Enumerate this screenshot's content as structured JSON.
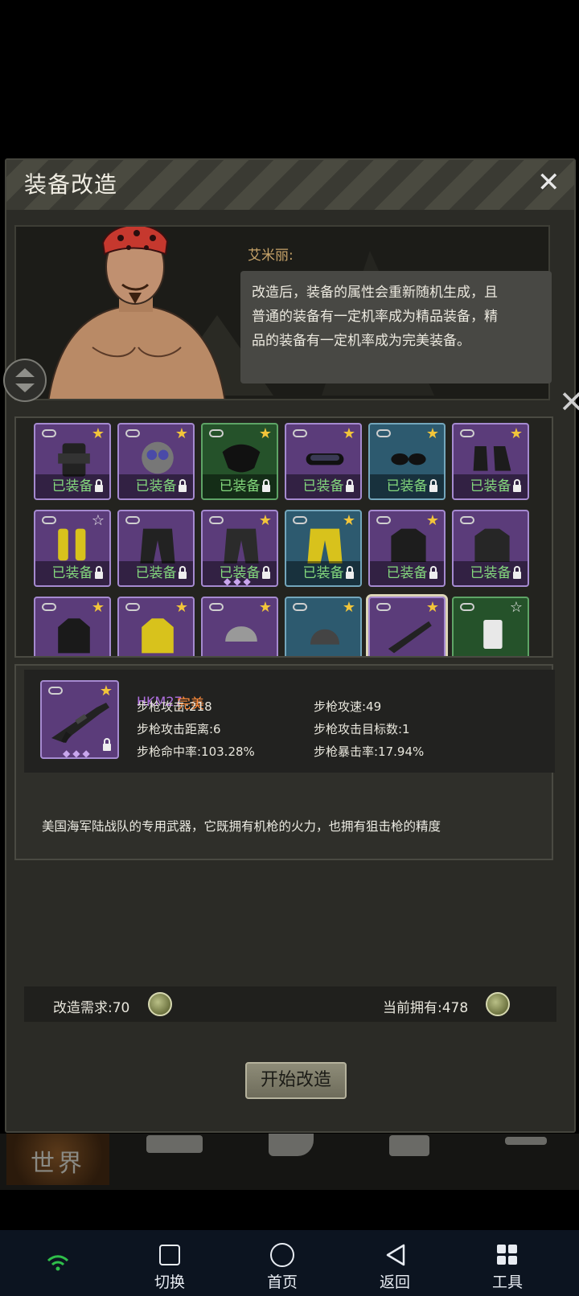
{
  "window": {
    "title": "装备改造"
  },
  "npc": {
    "speaker": "艾米丽:",
    "message_lines": [
      "改造后，装备的属性会重新随机生成，且",
      "普通的装备有一定机率成为精品装备，精",
      "品的装备有一定机率成为完美装备。"
    ]
  },
  "equipped_label": "已装备",
  "grid": {
    "rows": [
      [
        {
          "name": "tactical-vest",
          "color": "purple",
          "star": "gold",
          "equipped": true
        },
        {
          "name": "gas-mask",
          "color": "purple",
          "star": "gold",
          "equipped": true
        },
        {
          "name": "face-mask",
          "color": "green",
          "star": "gold",
          "equipped": true
        },
        {
          "name": "goggles",
          "color": "purple",
          "star": "gold",
          "equipped": true
        },
        {
          "name": "sunglasses",
          "color": "blue",
          "star": "gold",
          "equipped": true
        },
        {
          "name": "boots",
          "color": "purple",
          "star": "gold",
          "equipped": true
        }
      ],
      [
        {
          "name": "yellow-boots",
          "color": "purple",
          "star": "hollow",
          "equipped": true
        },
        {
          "name": "black-pants",
          "color": "purple",
          "star": "none",
          "equipped": true
        },
        {
          "name": "cargo-pants",
          "color": "purple",
          "star": "gold",
          "equipped": true,
          "diamonds": true
        },
        {
          "name": "yellow-pants",
          "color": "blue",
          "star": "gold",
          "equipped": true
        },
        {
          "name": "black-jacket",
          "color": "purple",
          "star": "gold",
          "equipped": true
        },
        {
          "name": "black-coat",
          "color": "purple",
          "star": "none",
          "equipped": true
        }
      ],
      [
        {
          "name": "dark-hoodie",
          "color": "purple",
          "star": "gold"
        },
        {
          "name": "yellow-hoodie",
          "color": "purple",
          "star": "gold"
        },
        {
          "name": "helmet",
          "color": "purple",
          "star": "gold"
        },
        {
          "name": "beanie",
          "color": "blue",
          "star": "gold"
        },
        {
          "name": "rifle",
          "color": "purple",
          "star": "gold",
          "selected": true
        },
        {
          "name": "can",
          "color": "green",
          "star": "hollow"
        }
      ]
    ]
  },
  "selected_item": {
    "name": "HKM27",
    "quality": "完美",
    "stats": [
      {
        "label": "步枪攻击:218"
      },
      {
        "label": "步枪攻速:49"
      },
      {
        "label": "步枪攻击距离:6"
      },
      {
        "label": "步枪攻击目标数:1"
      },
      {
        "label": "步枪命中率:103.28%"
      },
      {
        "label": "步枪暴击率:17.94%"
      }
    ],
    "description": "美国海军陆战队的专用武器，它既拥有机枪的火力，也拥有狙击枪的精度"
  },
  "cost": {
    "required": "改造需求:70",
    "owned": "当前拥有:478"
  },
  "start_button": "开始改造",
  "game_tabs": {
    "world": "世界"
  },
  "system_nav": {
    "switch": "切换",
    "home": "首页",
    "back": "返回",
    "tools": "工具"
  },
  "colors": {
    "panel": "#2b2b26",
    "purple_slot": "#5b3c7a",
    "green_slot": "#25522a",
    "blue_slot": "#2d5a6f",
    "equipped_text": "#84d97d",
    "quality_perfect": "#ff8b3a"
  }
}
